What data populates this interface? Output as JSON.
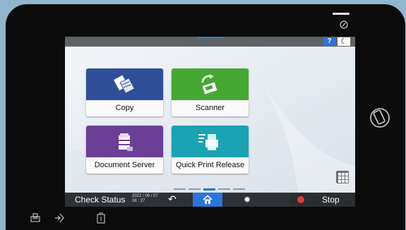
{
  "screen": {
    "help_label": "?",
    "night_icon": "moon-icon"
  },
  "tiles": [
    {
      "label": "Copy",
      "color": "#2f4f99",
      "icon": "copy-icon"
    },
    {
      "label": "Scanner",
      "color": "#45a833",
      "icon": "scanner-icon"
    },
    {
      "label": "Document Server",
      "color": "#6b3f95",
      "icon": "document-server-icon"
    },
    {
      "label": "Quick Print Release",
      "color": "#19a3b3",
      "icon": "quick-print-release-icon"
    }
  ],
  "navigation": {
    "prev_icon": "chevron-left-icon",
    "next_icon": "chevron-right-icon",
    "page_count": 5,
    "current_page": 3
  },
  "bottom_bar": {
    "check_status_label": "Check Status",
    "date": "2022 / 09 / 07",
    "time": "08 : 27",
    "back_icon": "back-icon",
    "home_icon": "home-icon",
    "settings_icon": "gear-icon",
    "stop_label": "Stop"
  },
  "device": {
    "power_icon": "power-icon",
    "phone_tap_icon": "phone-tap-icon"
  },
  "colors": {
    "accent": "#2b74d8",
    "bezel": "#0b0b0b",
    "stop": "#e33b2c"
  }
}
